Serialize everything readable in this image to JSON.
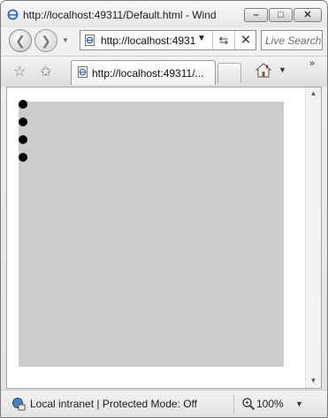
{
  "window": {
    "title": "http://localhost:49311/Default.html - Wind",
    "controls": {
      "minimize": "–",
      "maximize": "□",
      "close": "✕"
    }
  },
  "nav": {
    "back_icon": "back-arrow-icon",
    "forward_icon": "forward-arrow-icon",
    "back_glyph": "❮",
    "forward_glyph": "❯",
    "dropdown_glyph": "▼"
  },
  "address_bar": {
    "url": "http://localhost:4931",
    "dropdown_glyph": "▼",
    "refresh_glyph": "⇆",
    "stop_glyph": "✕"
  },
  "search": {
    "placeholder": "Live Search"
  },
  "tabs": {
    "favorites_glyph": "☆",
    "add_favorites_glyph": "✩",
    "active_label": "http://localhost:49311/...",
    "home_dropdown_glyph": "▼",
    "more_glyph": "»"
  },
  "content": {
    "box_color": "#cccccc",
    "bullet_count": 4
  },
  "scrollbar": {
    "up_glyph": "▲",
    "down_glyph": "▼"
  },
  "status": {
    "zone": "Local intranet | Protected Mode: Off",
    "zoom": "100%",
    "zoom_dropdown_glyph": "▼"
  }
}
